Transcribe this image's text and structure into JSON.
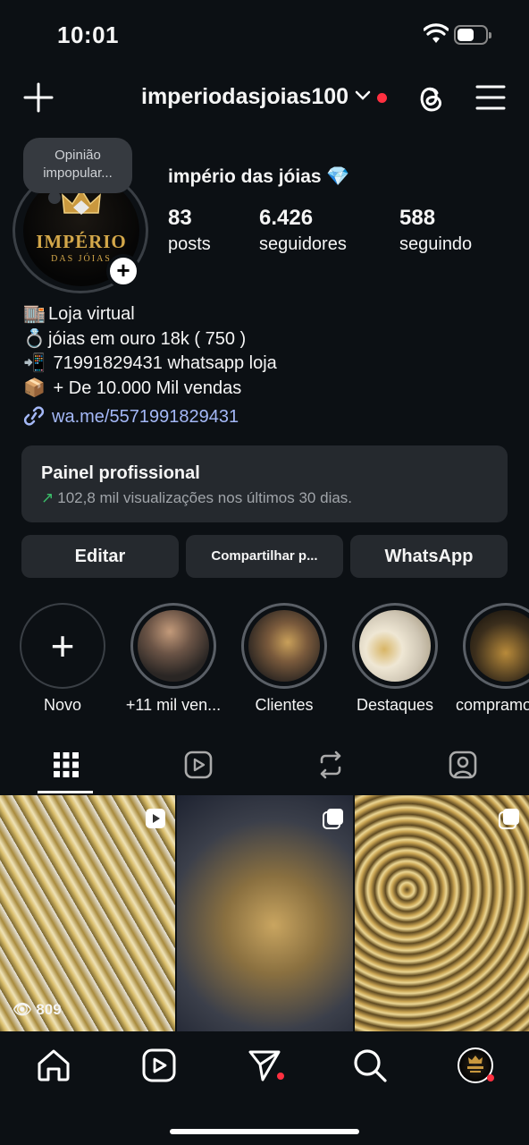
{
  "status": {
    "time": "10:01"
  },
  "header": {
    "username": "imperiodasjoias100"
  },
  "profile": {
    "note": "Opinião impopular...",
    "name": "império das jóias 💎",
    "avatar_logo": "IMPÉRIO",
    "avatar_logo_sub": "DAS JÓIAS",
    "stats": [
      {
        "value": "83",
        "label": "posts"
      },
      {
        "value": "6.426",
        "label": "seguidores"
      },
      {
        "value": "588",
        "label": "seguindo"
      }
    ],
    "bio": [
      {
        "emoji": "🏬",
        "text": "Loja virtual"
      },
      {
        "emoji": "💍",
        "text": "jóias em ouro 18k ( 750 )"
      },
      {
        "emoji": "📲",
        "text": " 71991829431 whatsapp loja"
      },
      {
        "emoji": "📦",
        "text": " + De 10.000 Mil vendas"
      }
    ],
    "link": "wa.me/5571991829431"
  },
  "panel": {
    "title": "Painel profissional",
    "subtitle": "102,8 mil visualizações nos últimos 30 dias."
  },
  "buttons": {
    "edit": "Editar",
    "share": "Compartilhar p...",
    "whatsapp": "WhatsApp"
  },
  "highlights": [
    {
      "label": "Novo"
    },
    {
      "label": "+11 mil ven..."
    },
    {
      "label": "Clientes"
    },
    {
      "label": "Destaques"
    },
    {
      "label": "compramos"
    }
  ],
  "tabs": [
    "grid-icon",
    "reels-icon",
    "reposts-icon",
    "tagged-icon"
  ],
  "posts": [
    {
      "type": "reel",
      "views": "809"
    },
    {
      "type": "carousel"
    },
    {
      "type": "carousel"
    }
  ],
  "colors": {
    "background": "#0c1014",
    "surface": "#25292e",
    "link": "#a4b8f7",
    "accent_red": "#ff3040",
    "gold": "#d4a84a"
  }
}
